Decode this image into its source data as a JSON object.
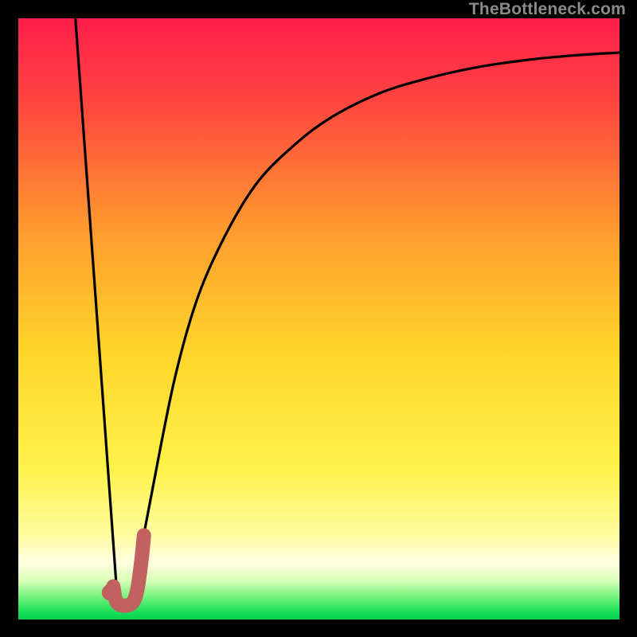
{
  "watermark": "TheBottleneck.com",
  "colors": {
    "grad_top": "#ff1e4b",
    "grad_mid1": "#ff6a2f",
    "grad_mid2": "#ffcf2a",
    "grad_mid3": "#fff95c",
    "grad_pale": "#ffffd2",
    "grad_green": "#38e568",
    "curve": "#000000",
    "marker": "#c86666",
    "bg": "#000000"
  },
  "chart_data": {
    "type": "line",
    "title": "",
    "xlabel": "",
    "ylabel": "",
    "xlim": [
      0,
      100
    ],
    "ylim": [
      0,
      100
    ],
    "series": [
      {
        "name": "left-segment",
        "x": [
          9.5,
          16.5
        ],
        "y": [
          100,
          3
        ]
      },
      {
        "name": "right-curve",
        "x": [
          19,
          22,
          26,
          30,
          35,
          40,
          46,
          52,
          60,
          68,
          76,
          84,
          92,
          100
        ],
        "y": [
          4,
          20,
          40,
          54,
          65,
          73,
          79,
          83.5,
          87.5,
          90,
          91.8,
          93,
          93.8,
          94.3
        ]
      }
    ],
    "marker": {
      "name": "j-shape-marker",
      "dot": {
        "x": 15.2,
        "y": 4.5
      },
      "stroke": [
        {
          "x": 15.8,
          "y": 5.5
        },
        {
          "x": 16.3,
          "y": 3.0
        },
        {
          "x": 17.5,
          "y": 2.3
        },
        {
          "x": 19.0,
          "y": 2.8
        },
        {
          "x": 19.8,
          "y": 5.0
        },
        {
          "x": 20.5,
          "y": 10.0
        },
        {
          "x": 20.9,
          "y": 14.0
        }
      ]
    },
    "gradient_bands": [
      {
        "y": 100,
        "color": "#ff1e4b"
      },
      {
        "y": 55,
        "color": "#ffcf2a"
      },
      {
        "y": 22,
        "color": "#fff95c"
      },
      {
        "y": 12,
        "color": "#ffffd2"
      },
      {
        "y": 3,
        "color": "#38e568"
      },
      {
        "y": 0,
        "color": "#00d94f"
      }
    ]
  }
}
